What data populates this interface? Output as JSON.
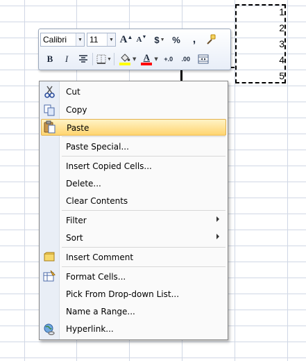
{
  "sheet": {
    "cells": [
      "1",
      "2",
      "3",
      "4",
      "5"
    ]
  },
  "mini_toolbar": {
    "font_name": "Calibri",
    "font_size": "11",
    "grow_font": "A",
    "shrink_font": "A",
    "currency": "$",
    "percent": "%",
    "comma": ",",
    "bold": "B",
    "italic": "I",
    "font_color_letter": "A",
    "increase_decimal": "+.0",
    "decrease_decimal": ".00",
    "colors": {
      "highlight": "#ffff00",
      "font": "#ff0000"
    },
    "icons": [
      "format-painter-icon",
      "center-align-icon",
      "borders-icon",
      "fill-color-icon",
      "merge-center-icon"
    ]
  },
  "context_menu": {
    "items": [
      {
        "label": "Cut",
        "icon": "scissors-icon"
      },
      {
        "label": "Copy",
        "icon": "copy-icon"
      },
      {
        "label": "Paste",
        "icon": "clipboard-icon",
        "highlighted": true
      },
      {
        "label": "Paste Special..."
      },
      {
        "label": "Insert Copied Cells..."
      },
      {
        "label": "Delete..."
      },
      {
        "label": "Clear Contents"
      },
      {
        "label": "Filter",
        "submenu": true
      },
      {
        "label": "Sort",
        "submenu": true
      },
      {
        "label": "Insert Comment",
        "icon": "comment-icon"
      },
      {
        "label": "Format Cells...",
        "icon": "format-cells-icon"
      },
      {
        "label": "Pick From Drop-down List..."
      },
      {
        "label": "Name a Range..."
      },
      {
        "label": "Hyperlink...",
        "icon": "globe-link-icon"
      }
    ],
    "highlight_color": "#ffd570"
  }
}
